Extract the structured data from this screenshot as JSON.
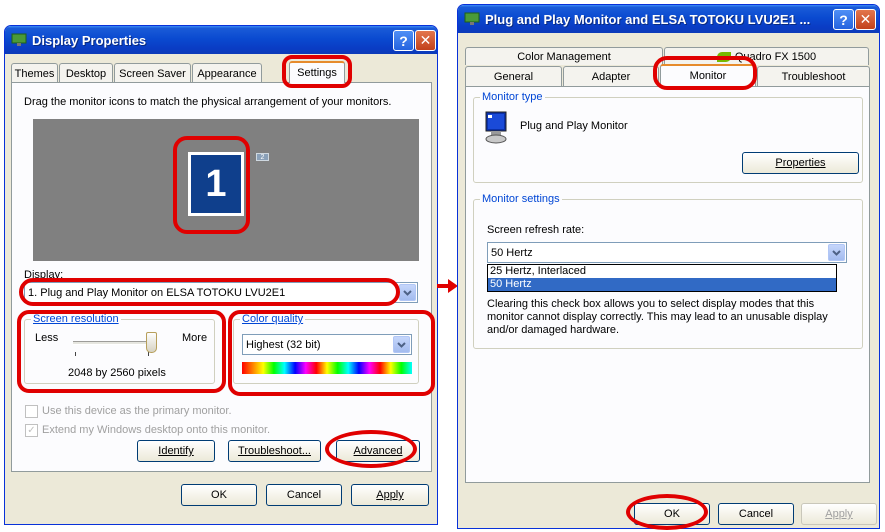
{
  "left_window": {
    "title": "Display Properties",
    "tabs": [
      "Themes",
      "Desktop",
      "Screen Saver",
      "Appearance",
      "Settings"
    ],
    "instruction": "Drag the monitor icons to match the physical arrangement of your monitors.",
    "monitor_primary_number": "1",
    "monitor_secondary_number": "2",
    "display_label": "Display:",
    "display_value": "1. Plug and Play Monitor on ELSA TOTOKU LVU2E1",
    "resolution": {
      "label": "Screen resolution",
      "less": "Less",
      "more": "More",
      "value": "2048 by 2560 pixels",
      "slider_level": 1.0
    },
    "color_quality": {
      "label": "Color quality",
      "value": "Highest (32 bit)"
    },
    "checkboxes": [
      {
        "label": "Use this device as the primary monitor.",
        "checked": false,
        "disabled": true
      },
      {
        "label": "Extend my Windows desktop onto this monitor.",
        "checked": true,
        "disabled": true
      }
    ],
    "buttons": {
      "identify": "Identify",
      "troubleshoot": "Troubleshoot...",
      "advanced": "Advanced",
      "ok": "OK",
      "cancel": "Cancel",
      "apply": "Apply"
    }
  },
  "right_window": {
    "title": "Plug and Play Monitor and ELSA TOTOKU LVU2E1 ...",
    "tabs_row1": [
      "Color Management",
      "Quadro FX 1500"
    ],
    "tabs_row2": [
      "General",
      "Adapter",
      "Monitor",
      "Troubleshoot"
    ],
    "monitor_type": {
      "legend": "Monitor type",
      "name": "Plug and Play Monitor",
      "properties_button": "Properties"
    },
    "monitor_settings": {
      "legend": "Monitor settings",
      "refresh_label": "Screen refresh rate:",
      "refresh_value": "50 Hertz",
      "options": [
        "25 Hertz, Interlaced",
        "50 Hertz"
      ],
      "selected_option": "50 Hertz",
      "description": [
        "Clearing this check box allows you to select display modes that this",
        "monitor cannot display correctly. This may lead to an unusable display",
        "and/or damaged hardware."
      ]
    },
    "buttons": {
      "ok": "OK",
      "cancel": "Cancel",
      "apply": "Apply"
    }
  },
  "colors": {
    "annotation_red": "#e00000",
    "title_blue": "#0a4ad0",
    "monitor_blue": "#0f3f8c",
    "preview_gray": "#808080",
    "selection_blue": "#316ac5"
  }
}
